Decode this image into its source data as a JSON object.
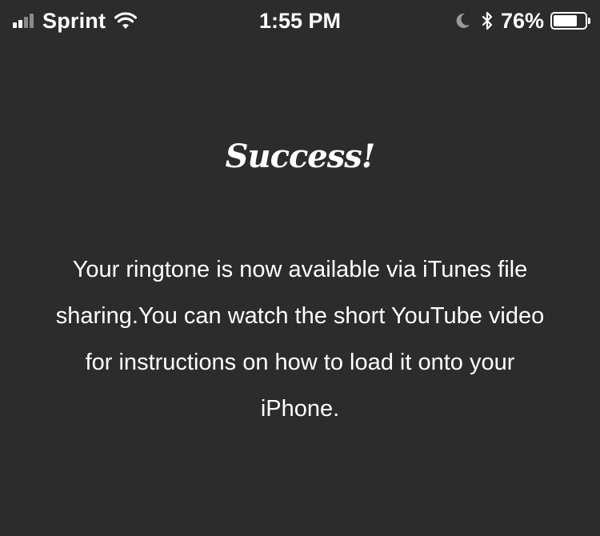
{
  "status_bar": {
    "carrier": "Sprint",
    "time": "1:55 PM",
    "battery_percent": "76%",
    "battery_level": 0.76,
    "signal_strength": 2,
    "signal_max": 4,
    "icons": [
      "signal-bars-icon",
      "wifi-icon",
      "moon-icon",
      "bluetooth-icon",
      "battery-icon"
    ]
  },
  "main": {
    "title": "Success!",
    "message": "Your ringtone is now available via iTunes file sharing.You can watch the short YouTube video for instructions on how to load it onto your iPhone."
  },
  "colors": {
    "background": "#2b2b2c",
    "text": "#ffffff",
    "signal_inactive": "#8a8a8a"
  }
}
